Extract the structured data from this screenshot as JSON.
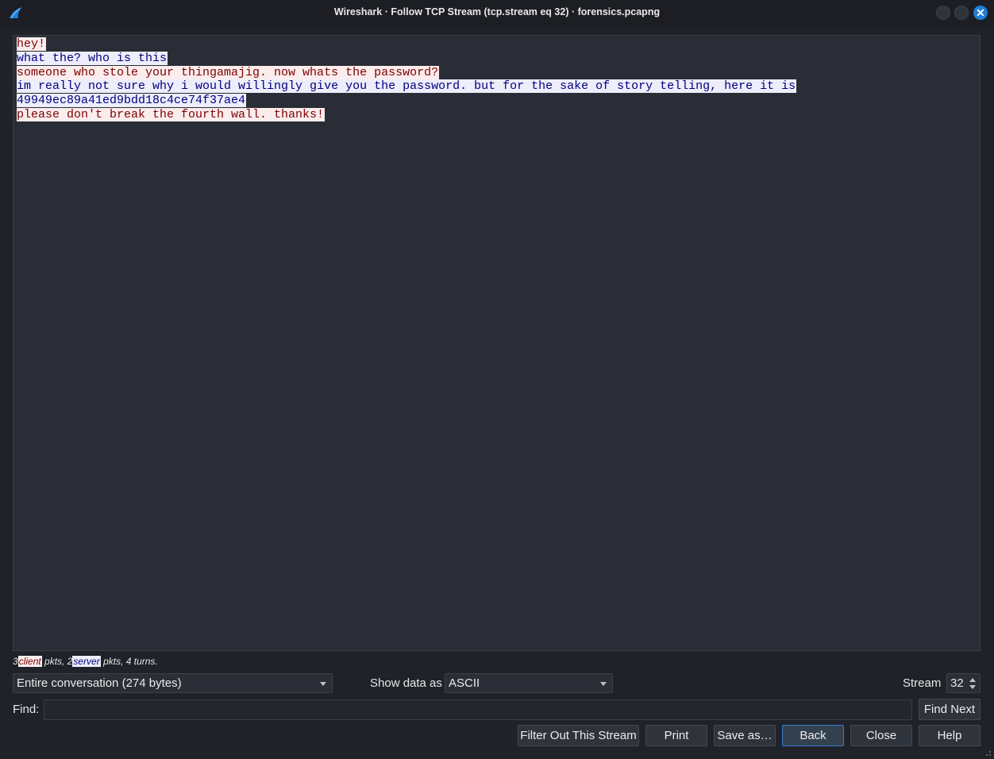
{
  "window": {
    "title": "Wireshark · Follow TCP Stream (tcp.stream eq 32) · forensics.pcapng",
    "close_glyph": "✕"
  },
  "stream": {
    "lines": [
      {
        "dir": "client",
        "text": "hey!"
      },
      {
        "dir": "server",
        "text": "what the? who is this"
      },
      {
        "dir": "client",
        "text": "someone who stole your thingamajig. now whats the password?"
      },
      {
        "dir": "server",
        "text": "im really not sure why i would willingly give you the password. but for the sake of story telling, here it is"
      },
      {
        "dir": "server",
        "text": "49949ec89a41ed9bdd18c4ce74f37ae4"
      },
      {
        "dir": "client",
        "text": "please don't break the fourth wall. thanks!"
      }
    ]
  },
  "stats": {
    "client_count": "3",
    "client_label": "client",
    "mid": " pkts, 2",
    "server_label": "server",
    "tail": " pkts, 4 turns."
  },
  "controls": {
    "conversation_selected": "Entire conversation (274 bytes)",
    "show_data_as_label": "Show data as",
    "show_data_as_selected": "ASCII",
    "stream_label": "Stream",
    "stream_value": "32",
    "find_label": "Find:",
    "find_value": "",
    "find_next_label": "Find Next"
  },
  "buttons": {
    "filter_out": "Filter Out This Stream",
    "print": "Print",
    "save_as": "Save as…",
    "back": "Back",
    "close": "Close",
    "help": "Help"
  },
  "colors": {
    "client_bg": "#fbeded",
    "client_fg": "#7f0000",
    "server_bg": "#ededfb",
    "server_fg": "#00007f",
    "accent": "#1e7ed6"
  },
  "icons": [
    "wireshark-fin-icon",
    "minimize-icon",
    "maximize-icon",
    "close-icon",
    "dropdown-arrow-icon",
    "spin-up-icon",
    "spin-down-icon",
    "resize-grip-icon"
  ]
}
